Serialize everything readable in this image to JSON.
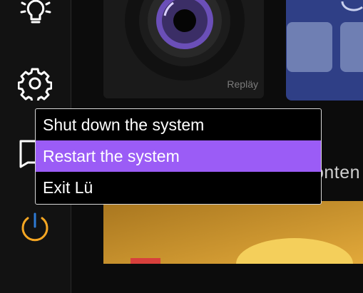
{
  "sidebar": {
    "items": [
      {
        "icon": "lightbulb-icon"
      },
      {
        "icon": "gear-icon"
      },
      {
        "icon": "help-icon"
      },
      {
        "icon": "power-icon",
        "color": "#f5a623",
        "accent": "#2e7bd6"
      }
    ]
  },
  "content": {
    "card_caption": "Repläy",
    "partial_heading": "onten"
  },
  "power_menu": {
    "items": [
      {
        "label": "Shut down the system",
        "selected": false
      },
      {
        "label": "Restart the system",
        "selected": true
      },
      {
        "label": "Exit Lü",
        "selected": false
      }
    ],
    "highlight_color": "#9b5cf6"
  }
}
